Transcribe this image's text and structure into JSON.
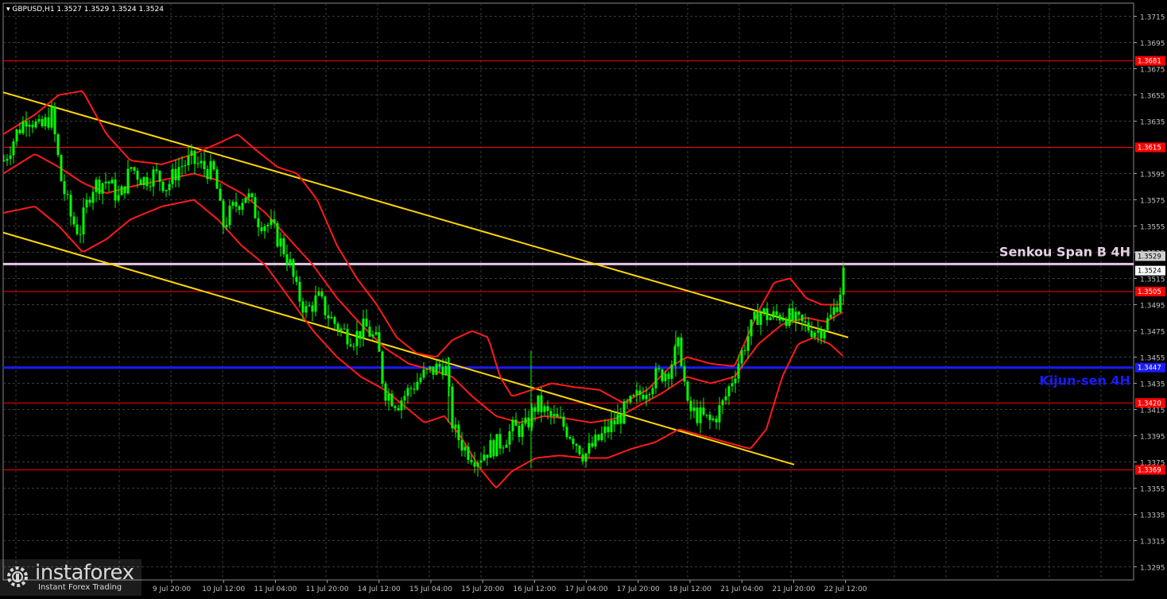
{
  "header": {
    "symbol": "GBPUSD,H1",
    "ohlc": "1.3527 1.3529 1.3524 1.3524"
  },
  "labels": {
    "senkou": "Senkou Span B 4H",
    "kijun": "Kijun-sen 4H"
  },
  "logo": {
    "name": "instaforex",
    "tagline": "Instant Forex Trading"
  },
  "colors": {
    "background": "#000000",
    "grid": "#3a3a3a",
    "candles": "#00ff00",
    "bollinger": "#ff1a1a",
    "channel": "#ffd700",
    "support_resistance": "#ff0000",
    "kijun": "#1a1aff",
    "senkou": "#e8c6e8",
    "axis_text": "#c0c0c0"
  },
  "chart_data": {
    "type": "candlestick",
    "title": "GBPUSD,H1",
    "ylim": [
      1.3285,
      1.3725
    ],
    "y_ticks": [
      "1.3715",
      "1.3695",
      "1.3675",
      "1.3655",
      "1.3635",
      "1.3595",
      "1.3575",
      "1.3555",
      "1.3535",
      "1.3515",
      "1.3495",
      "1.3475",
      "1.3455",
      "1.3435",
      "1.3415",
      "1.3395",
      "1.3375",
      "1.3355",
      "1.3335",
      "1.3315",
      "1.3295"
    ],
    "x_ticks": [
      "9 Jul 20:00",
      "10 Jul 12:00",
      "11 Jul 04:00",
      "11 Jul 20:00",
      "14 Jul 12:00",
      "15 Jul 04:00",
      "15 Jul 20:00",
      "16 Jul 12:00",
      "17 Jul 04:00",
      "17 Jul 20:00",
      "18 Jul 12:00",
      "21 Jul 04:00",
      "21 Jul 20:00",
      "22 Jul 12:00"
    ],
    "levels": [
      {
        "label": "1.3681",
        "value": 1.3681,
        "type": "resistance"
      },
      {
        "label": "1.3615",
        "value": 1.3615,
        "type": "resistance"
      },
      {
        "label": "1.3529",
        "value": 1.3529,
        "type": "price"
      },
      {
        "label": "1.3524",
        "value": 1.3524,
        "type": "price"
      },
      {
        "label": "1.3505",
        "value": 1.3505,
        "type": "resistance"
      },
      {
        "label": "1.3447",
        "value": 1.3447,
        "type": "kijun"
      },
      {
        "label": "1.3420",
        "value": 1.342,
        "type": "support"
      },
      {
        "label": "1.3369",
        "value": 1.3369,
        "type": "support"
      }
    ],
    "senkou_span_b": 1.3526,
    "kijun_sen": 1.3447,
    "channel_upper": [
      [
        0,
        1.3657
      ],
      [
        1063,
        1.347
      ]
    ],
    "channel_lower": [
      [
        0,
        1.355
      ],
      [
        995,
        1.3373
      ]
    ],
    "close_path": [
      [
        0,
        1.3605
      ],
      [
        15,
        1.3625
      ],
      [
        30,
        1.364
      ],
      [
        45,
        1.3628
      ],
      [
        60,
        1.364
      ],
      [
        72,
        1.359
      ],
      [
        85,
        1.356
      ],
      [
        95,
        1.355
      ],
      [
        110,
        1.3585
      ],
      [
        130,
        1.359
      ],
      [
        145,
        1.3575
      ],
      [
        160,
        1.36
      ],
      [
        175,
        1.359
      ],
      [
        190,
        1.3595
      ],
      [
        205,
        1.3585
      ],
      [
        220,
        1.36
      ],
      [
        235,
        1.3605
      ],
      [
        250,
        1.36
      ],
      [
        265,
        1.3595
      ],
      [
        275,
        1.3555
      ],
      [
        290,
        1.357
      ],
      [
        305,
        1.358
      ],
      [
        320,
        1.356
      ],
      [
        335,
        1.3555
      ],
      [
        350,
        1.354
      ],
      [
        360,
        1.3525
      ],
      [
        368,
        1.3505
      ],
      [
        380,
        1.349
      ],
      [
        395,
        1.35
      ],
      [
        410,
        1.3485
      ],
      [
        425,
        1.3475
      ],
      [
        440,
        1.347
      ],
      [
        455,
        1.3478
      ],
      [
        470,
        1.3465
      ],
      [
        478,
        1.343
      ],
      [
        495,
        1.342
      ],
      [
        510,
        1.343
      ],
      [
        525,
        1.344
      ],
      [
        540,
        1.3445
      ],
      [
        555,
        1.345
      ],
      [
        565,
        1.34
      ],
      [
        580,
        1.3385
      ],
      [
        595,
        1.3378
      ],
      [
        610,
        1.3385
      ],
      [
        625,
        1.339
      ],
      [
        640,
        1.34
      ],
      [
        655,
        1.34
      ],
      [
        670,
        1.342
      ],
      [
        685,
        1.341
      ],
      [
        700,
        1.3405
      ],
      [
        715,
        1.3395
      ],
      [
        730,
        1.338
      ],
      [
        745,
        1.339
      ],
      [
        760,
        1.34
      ],
      [
        775,
        1.341
      ],
      [
        790,
        1.342
      ],
      [
        805,
        1.343
      ],
      [
        820,
        1.344
      ],
      [
        835,
        1.3445
      ],
      [
        850,
        1.3465
      ],
      [
        860,
        1.3415
      ],
      [
        875,
        1.341
      ],
      [
        890,
        1.3405
      ],
      [
        905,
        1.342
      ],
      [
        920,
        1.3445
      ],
      [
        935,
        1.347
      ],
      [
        950,
        1.349
      ],
      [
        965,
        1.3485
      ],
      [
        980,
        1.3488
      ],
      [
        995,
        1.3482
      ],
      [
        1010,
        1.3478
      ],
      [
        1025,
        1.3475
      ],
      [
        1040,
        1.3485
      ],
      [
        1050,
        1.35
      ],
      [
        1058,
        1.3526
      ]
    ],
    "bollinger_upper": [
      [
        0,
        1.3625
      ],
      [
        40,
        1.364
      ],
      [
        70,
        1.3655
      ],
      [
        100,
        1.3658
      ],
      [
        130,
        1.3625
      ],
      [
        160,
        1.3605
      ],
      [
        200,
        1.3602
      ],
      [
        240,
        1.361
      ],
      [
        270,
        1.3618
      ],
      [
        295,
        1.3625
      ],
      [
        320,
        1.3612
      ],
      [
        345,
        1.36
      ],
      [
        370,
        1.3595
      ],
      [
        395,
        1.3575
      ],
      [
        420,
        1.354
      ],
      [
        445,
        1.3515
      ],
      [
        470,
        1.3495
      ],
      [
        495,
        1.347
      ],
      [
        520,
        1.3458
      ],
      [
        545,
        1.3455
      ],
      [
        565,
        1.3468
      ],
      [
        590,
        1.3475
      ],
      [
        610,
        1.347
      ],
      [
        625,
        1.344
      ],
      [
        640,
        1.3425
      ],
      [
        665,
        1.343
      ],
      [
        690,
        1.3435
      ],
      [
        720,
        1.3432
      ],
      [
        750,
        1.343
      ],
      [
        780,
        1.342
      ],
      [
        810,
        1.343
      ],
      [
        840,
        1.3448
      ],
      [
        860,
        1.3455
      ],
      [
        890,
        1.345
      ],
      [
        920,
        1.3448
      ],
      [
        950,
        1.349
      ],
      [
        970,
        1.3512
      ],
      [
        990,
        1.3515
      ],
      [
        1010,
        1.35
      ],
      [
        1030,
        1.3495
      ],
      [
        1050,
        1.3495
      ],
      [
        1058,
        1.3496
      ]
    ],
    "bollinger_middle": [
      [
        0,
        1.3595
      ],
      [
        40,
        1.361
      ],
      [
        70,
        1.36
      ],
      [
        100,
        1.3588
      ],
      [
        130,
        1.358
      ],
      [
        160,
        1.3585
      ],
      [
        200,
        1.359
      ],
      [
        240,
        1.3595
      ],
      [
        270,
        1.359
      ],
      [
        300,
        1.358
      ],
      [
        330,
        1.3565
      ],
      [
        360,
        1.3545
      ],
      [
        390,
        1.3525
      ],
      [
        420,
        1.35
      ],
      [
        450,
        1.348
      ],
      [
        480,
        1.3462
      ],
      [
        510,
        1.345
      ],
      [
        540,
        1.3445
      ],
      [
        565,
        1.344
      ],
      [
        590,
        1.3425
      ],
      [
        620,
        1.341
      ],
      [
        650,
        1.3405
      ],
      [
        680,
        1.341
      ],
      [
        710,
        1.3408
      ],
      [
        740,
        1.3405
      ],
      [
        770,
        1.3408
      ],
      [
        800,
        1.3418
      ],
      [
        830,
        1.3428
      ],
      [
        860,
        1.344
      ],
      [
        890,
        1.3435
      ],
      [
        920,
        1.344
      ],
      [
        950,
        1.3465
      ],
      [
        980,
        1.348
      ],
      [
        1010,
        1.3485
      ],
      [
        1035,
        1.3482
      ],
      [
        1058,
        1.349
      ]
    ],
    "bollinger_lower": [
      [
        0,
        1.3565
      ],
      [
        40,
        1.357
      ],
      [
        70,
        1.3555
      ],
      [
        100,
        1.3535
      ],
      [
        130,
        1.3545
      ],
      [
        160,
        1.356
      ],
      [
        200,
        1.357
      ],
      [
        240,
        1.3575
      ],
      [
        270,
        1.356
      ],
      [
        300,
        1.354
      ],
      [
        330,
        1.3525
      ],
      [
        360,
        1.35
      ],
      [
        390,
        1.3475
      ],
      [
        420,
        1.3455
      ],
      [
        450,
        1.344
      ],
      [
        480,
        1.343
      ],
      [
        510,
        1.3415
      ],
      [
        530,
        1.3405
      ],
      [
        555,
        1.341
      ],
      [
        575,
        1.3395
      ],
      [
        600,
        1.337
      ],
      [
        620,
        1.3355
      ],
      [
        640,
        1.3368
      ],
      [
        670,
        1.3378
      ],
      [
        700,
        1.338
      ],
      [
        730,
        1.3378
      ],
      [
        760,
        1.3378
      ],
      [
        790,
        1.3385
      ],
      [
        820,
        1.339
      ],
      [
        850,
        1.34
      ],
      [
        880,
        1.3395
      ],
      [
        910,
        1.339
      ],
      [
        940,
        1.3385
      ],
      [
        960,
        1.34
      ],
      [
        980,
        1.344
      ],
      [
        1000,
        1.3465
      ],
      [
        1020,
        1.347
      ],
      [
        1040,
        1.3465
      ],
      [
        1058,
        1.3455
      ]
    ]
  }
}
